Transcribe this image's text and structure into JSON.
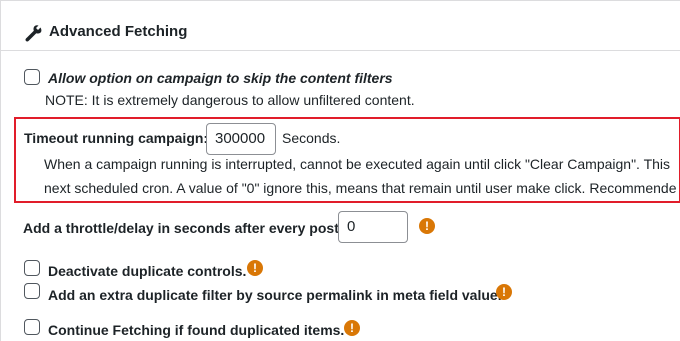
{
  "section": {
    "title": "Advanced Fetching",
    "icon": "wrench-icon"
  },
  "skip_filters": {
    "label": "Allow option on campaign to skip the content filters",
    "note": "NOTE: It is extremely dangerous to allow unfiltered content."
  },
  "timeout": {
    "label": "Timeout running campaign:",
    "value": "300000",
    "unit": "Seconds.",
    "desc_line1": "When a campaign running is interrupted, cannot be executed again until click \"Clear Campaign\". This",
    "desc_line2": "next scheduled cron. A value of \"0\" ignore this, means that remain until user make click. Recommende",
    "highlight_color": "#e11d2a"
  },
  "throttle": {
    "label": "Add a throttle/delay in seconds after every post.",
    "value": "0",
    "info_icon": "exclamation-icon"
  },
  "options": [
    {
      "label": "Deactivate duplicate controls."
    },
    {
      "label": "Add an extra duplicate filter by source permalink in meta field value."
    },
    {
      "label": "Continue Fetching if found duplicated items."
    }
  ],
  "colors": {
    "warning": "#d97706",
    "text": "#1d2327"
  }
}
